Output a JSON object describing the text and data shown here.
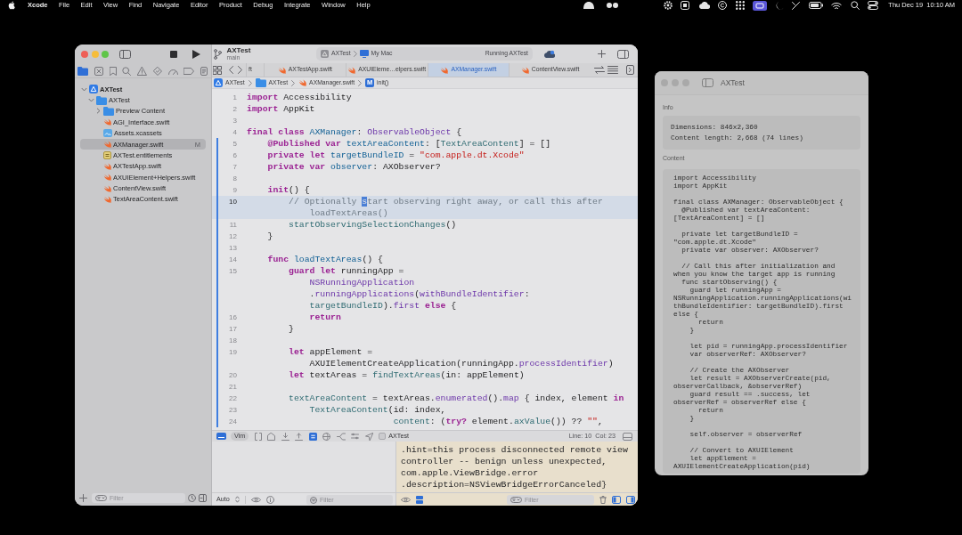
{
  "menu_bar": {
    "app_name": "Xcode",
    "menus": [
      "File",
      "Edit",
      "View",
      "Find",
      "Navigate",
      "Editor",
      "Product",
      "Debug",
      "Integrate",
      "Window",
      "Help"
    ],
    "clock": "Thu Dec 19  10:10 AM"
  },
  "xcode": {
    "toolbar": {
      "project": "AXTest",
      "branch": "main",
      "scheme": "AXTest",
      "destination": "My Mac",
      "activity": "Running AXTest"
    },
    "navigator_tabs": [
      {
        "kind": "folder",
        "selected": true
      },
      {
        "kind": "source-control",
        "selected": false
      },
      {
        "kind": "bookmarks",
        "selected": false
      },
      {
        "kind": "find",
        "selected": false
      },
      {
        "kind": "issues",
        "selected": false
      },
      {
        "kind": "tests",
        "selected": false
      },
      {
        "kind": "debug",
        "selected": false
      },
      {
        "kind": "breakpoints",
        "selected": false
      },
      {
        "kind": "reports",
        "selected": false
      }
    ],
    "tree": [
      {
        "kind": "project",
        "name": "AXTest",
        "expanded": true,
        "selected": false,
        "children": [
          {
            "kind": "folder",
            "name": "AXTest",
            "expanded": true,
            "selected": false,
            "children": [
              {
                "kind": "folder",
                "name": "Preview Content",
                "expanded": false,
                "selected": false
              },
              {
                "kind": "swift",
                "name": "AGI_Interface.swift",
                "selected": false
              },
              {
                "kind": "assets",
                "name": "Assets.xcassets",
                "selected": false
              },
              {
                "kind": "swift",
                "name": "AXManager.swift",
                "selected": true,
                "status": "M"
              },
              {
                "kind": "entitlements",
                "name": "AXTest.entitlements",
                "selected": false
              },
              {
                "kind": "swift",
                "name": "AXTestApp.swift",
                "selected": false
              },
              {
                "kind": "swift",
                "name": "AXUIElement+Helpers.swift",
                "selected": false
              },
              {
                "kind": "swift",
                "name": "ContentView.swift",
                "selected": false
              },
              {
                "kind": "swift",
                "name": "TextAreaContent.swift",
                "selected": false
              }
            ]
          }
        ]
      }
    ],
    "sidebar_filter": {
      "placeholder": "Filter"
    },
    "tabs": [
      {
        "label": "ft",
        "kind": "fragment",
        "selected": false
      },
      {
        "label": "AXTestApp.swift",
        "kind": "swift",
        "selected": false
      },
      {
        "label": "AXUIEleme…elpers.swift",
        "kind": "swift",
        "selected": false
      },
      {
        "label": "AXManager.swift",
        "kind": "swift",
        "selected": true
      },
      {
        "label": "ContentView.swift",
        "kind": "swift",
        "selected": false
      }
    ],
    "jump_bar": [
      {
        "kind": "project",
        "label": "AXTest"
      },
      {
        "kind": "folder",
        "label": "AXTest"
      },
      {
        "kind": "swift",
        "label": "AXManager.swift"
      },
      {
        "kind": "method",
        "badge": "M",
        "label": "init()"
      }
    ],
    "editor": {
      "lines": [
        {
          "number": "1",
          "current": false,
          "changed": false,
          "wrapped_lines": [
            {
              "tokens": [
                {
                  "kind": "keyword",
                  "text": "import"
                },
                {
                  "kind": "plain",
                  "text": " Accessibility"
                }
              ]
            }
          ]
        },
        {
          "number": "2",
          "current": false,
          "changed": false,
          "wrapped_lines": [
            {
              "tokens": [
                {
                  "kind": "keyword",
                  "text": "import"
                },
                {
                  "kind": "plain",
                  "text": " AppKit"
                }
              ]
            }
          ]
        },
        {
          "number": "3",
          "current": false,
          "changed": false
        },
        {
          "number": "4",
          "current": false,
          "changed": false,
          "wrapped_lines": [
            {
              "tokens": [
                {
                  "kind": "keyword",
                  "text": "final class "
                },
                {
                  "kind": "declaration",
                  "text": "AXManager"
                },
                {
                  "kind": "plain",
                  "text": ": "
                },
                {
                  "kind": "system",
                  "text": "ObservableObject"
                },
                {
                  "kind": "plain",
                  "text": " {"
                }
              ]
            }
          ]
        },
        {
          "number": "5",
          "current": false,
          "changed": true,
          "wrapped_lines": [
            {
              "tokens": [
                {
                  "kind": "keyword",
                  "text": "    @Published var "
                },
                {
                  "kind": "declaration",
                  "text": "textAreaContent"
                },
                {
                  "kind": "plain",
                  "text": ": ["
                },
                {
                  "kind": "reference",
                  "text": "TextAreaContent"
                },
                {
                  "kind": "plain",
                  "text": "] = []"
                }
              ]
            }
          ]
        },
        {
          "number": "6",
          "current": false,
          "changed": true,
          "wrapped_lines": [
            {
              "tokens": [
                {
                  "kind": "keyword",
                  "text": "    private let "
                },
                {
                  "kind": "declaration",
                  "text": "targetBundleID"
                },
                {
                  "kind": "plain",
                  "text": " = "
                },
                {
                  "kind": "string",
                  "text": "\"com.apple.dt.Xcode\""
                }
              ]
            }
          ]
        },
        {
          "number": "7",
          "current": false,
          "changed": true,
          "wrapped_lines": [
            {
              "tokens": [
                {
                  "kind": "keyword",
                  "text": "    private var "
                },
                {
                  "kind": "declaration",
                  "text": "observer"
                },
                {
                  "kind": "plain",
                  "text": ": AXObserver?"
                }
              ]
            }
          ]
        },
        {
          "number": "8",
          "current": false,
          "changed": true
        },
        {
          "number": "9",
          "current": false,
          "changed": true,
          "wrapped_lines": [
            {
              "tokens": [
                {
                  "kind": "keyword",
                  "text": "    init"
                },
                {
                  "kind": "plain",
                  "text": "() {"
                }
              ]
            }
          ]
        },
        {
          "number": "10",
          "current": true,
          "changed": true,
          "wrapped_lines": [
            {
              "tokens": [
                {
                  "kind": "comment",
                  "text": "        // Optionally "
                },
                {
                  "kind": "cursor",
                  "text": "s"
                },
                {
                  "kind": "comment",
                  "text": "tart observing right away, or call this after"
                }
              ]
            },
            {
              "tokens": [
                {
                  "kind": "comment",
                  "text": "            loadTextAreas()"
                }
              ]
            }
          ]
        },
        {
          "number": "11",
          "current": false,
          "changed": true,
          "wrapped_lines": [
            {
              "tokens": [
                {
                  "kind": "reference",
                  "text": "        startObservingSelectionChanges"
                },
                {
                  "kind": "plain",
                  "text": "()"
                }
              ]
            }
          ]
        },
        {
          "number": "12",
          "current": false,
          "changed": true,
          "wrapped_lines": [
            {
              "tokens": [
                {
                  "kind": "plain",
                  "text": "    }"
                }
              ]
            }
          ]
        },
        {
          "number": "13",
          "current": false,
          "changed": true
        },
        {
          "number": "14",
          "current": false,
          "changed": true,
          "wrapped_lines": [
            {
              "tokens": [
                {
                  "kind": "keyword",
                  "text": "    func "
                },
                {
                  "kind": "declaration",
                  "text": "loadTextAreas"
                },
                {
                  "kind": "plain",
                  "text": "() {"
                }
              ]
            }
          ]
        },
        {
          "number": "15",
          "current": false,
          "changed": true,
          "wrapped_lines": [
            {
              "tokens": [
                {
                  "kind": "keyword",
                  "text": "        guard let "
                },
                {
                  "kind": "plain",
                  "text": "runningApp ="
                }
              ]
            },
            {
              "tokens": [
                {
                  "kind": "system",
                  "text": "            NSRunningApplication"
                }
              ]
            },
            {
              "tokens": [
                {
                  "kind": "plain",
                  "text": "            ."
                },
                {
                  "kind": "system",
                  "text": "runningApplications"
                },
                {
                  "kind": "plain",
                  "text": "("
                },
                {
                  "kind": "system",
                  "text": "withBundleIdentifier"
                },
                {
                  "kind": "plain",
                  "text": ":"
                }
              ]
            },
            {
              "tokens": [
                {
                  "kind": "reference",
                  "text": "            targetBundleID"
                },
                {
                  "kind": "plain",
                  "text": ")."
                },
                {
                  "kind": "system",
                  "text": "first"
                },
                {
                  "kind": "keyword",
                  "text": " else"
                },
                {
                  "kind": "plain",
                  "text": " {"
                }
              ]
            }
          ]
        },
        {
          "number": "16",
          "current": false,
          "changed": true,
          "wrapped_lines": [
            {
              "tokens": [
                {
                  "kind": "keyword",
                  "text": "            return"
                }
              ]
            }
          ]
        },
        {
          "number": "17",
          "current": false,
          "changed": true,
          "wrapped_lines": [
            {
              "tokens": [
                {
                  "kind": "plain",
                  "text": "        }"
                }
              ]
            }
          ]
        },
        {
          "number": "18",
          "current": false,
          "changed": true
        },
        {
          "number": "19",
          "current": false,
          "changed": true,
          "wrapped_lines": [
            {
              "tokens": [
                {
                  "kind": "keyword",
                  "text": "        let "
                },
                {
                  "kind": "plain",
                  "text": "appElement ="
                }
              ]
            },
            {
              "tokens": [
                {
                  "kind": "plain",
                  "text": "            AXUIElementCreateApplication(runningApp."
                },
                {
                  "kind": "system",
                  "text": "processIdentifier"
                },
                {
                  "kind": "plain",
                  "text": ")"
                }
              ]
            }
          ]
        },
        {
          "number": "20",
          "current": false,
          "changed": true,
          "wrapped_lines": [
            {
              "tokens": [
                {
                  "kind": "keyword",
                  "text": "        let "
                },
                {
                  "kind": "plain",
                  "text": "textAreas = "
                },
                {
                  "kind": "reference",
                  "text": "findTextAreas"
                },
                {
                  "kind": "plain",
                  "text": "(in: appElement)"
                }
              ]
            }
          ]
        },
        {
          "number": "21",
          "current": false,
          "changed": true
        },
        {
          "number": "22",
          "current": false,
          "changed": true,
          "wrapped_lines": [
            {
              "tokens": [
                {
                  "kind": "reference",
                  "text": "        textAreaContent"
                },
                {
                  "kind": "plain",
                  "text": " = textAreas."
                },
                {
                  "kind": "system",
                  "text": "enumerated"
                },
                {
                  "kind": "plain",
                  "text": "()."
                },
                {
                  "kind": "system",
                  "text": "map"
                },
                {
                  "kind": "plain",
                  "text": " { index, element "
                },
                {
                  "kind": "keyword",
                  "text": "in"
                }
              ]
            }
          ]
        },
        {
          "number": "23",
          "current": false,
          "changed": true,
          "wrapped_lines": [
            {
              "tokens": [
                {
                  "kind": "reference",
                  "text": "            TextAreaContent"
                },
                {
                  "kind": "plain",
                  "text": "(id: index,"
                }
              ]
            }
          ]
        },
        {
          "number": "24",
          "current": false,
          "changed": true,
          "wrapped_lines": [
            {
              "tokens": [
                {
                  "kind": "reference",
                  "text": "                            content"
                },
                {
                  "kind": "plain",
                  "text": ": ("
                },
                {
                  "kind": "keyword",
                  "text": "try?"
                },
                {
                  "kind": "plain",
                  "text": " element."
                },
                {
                  "kind": "reference",
                  "text": "axValue"
                },
                {
                  "kind": "plain",
                  "text": "()) ?? "
                },
                {
                  "kind": "string",
                  "text": "\"\""
                },
                {
                  "kind": "plain",
                  "text": ","
                }
              ]
            }
          ]
        }
      ]
    },
    "debug_bar": {
      "mode": "Vim",
      "target": "AXTest",
      "cursor_position": "Line: 10  Col: 23"
    },
    "variables": {
      "scope": "Auto",
      "filter": {
        "placeholder": "Filter"
      }
    },
    "console": {
      "lines": [
        ".hint=this process disconnected remote view",
        "controller -- benign unless unexpected,",
        "com.apple.ViewBridge.error",
        ".description=NSViewBridgeErrorCanceled}"
      ],
      "filter": {
        "placeholder": "Filter"
      }
    }
  },
  "inspector_window": {
    "title": "AXTest",
    "info_label": "Info",
    "info": [
      "Dimensions: 846x2,360",
      "Content length: 2,668 (74 lines)"
    ],
    "content_label": "Content",
    "paragraphs": [
      {
        "lines": [
          "import Accessibility",
          "import AppKit"
        ]
      },
      {
        "lines": [
          "final class AXManager: ObservableObject {",
          "  @Published var textAreaContent: [TextAreaContent] = []"
        ]
      },
      {
        "lines": [
          "  private let targetBundleID = \"com.apple.dt.Xcode\"",
          "  private var observer: AXObserver?"
        ]
      },
      {
        "lines": [
          "  // Call this after initialization and when you know the target app is running",
          "  func startObserving() {",
          "    guard let runningApp = NSRunningApplication.runningApplications(withBundleIdentifier: targetBundleID).first else {",
          "      return",
          "    }"
        ]
      },
      {
        "lines": [
          "    let pid = runningApp.processIdentifier",
          "    var observerRef: AXObserver?"
        ]
      },
      {
        "lines": [
          "    // Create the AXObserver",
          "    let result = AXObserverCreate(pid, observerCallback, &observerRef)",
          "    guard result == .success, let observerRef = observerRef else {",
          "      return",
          "    }"
        ]
      },
      {
        "lines": [
          "    self.observer = observerRef"
        ]
      },
      {
        "lines": [
          "    // Convert to AXUIElement",
          "    let appElement = AXUIElementCreateApplication(pid)"
        ]
      }
    ]
  }
}
